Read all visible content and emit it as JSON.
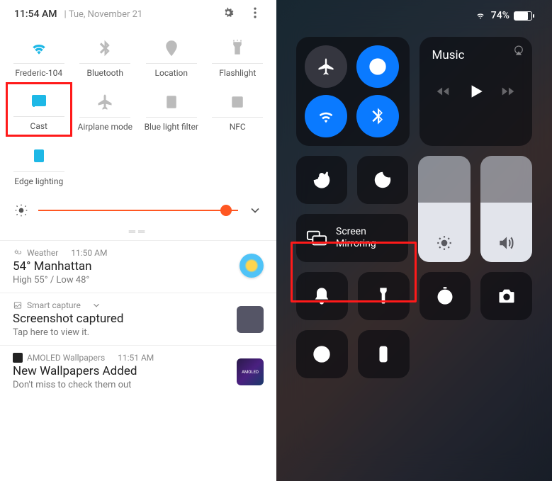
{
  "android": {
    "time": "11:54 AM",
    "date": "Tue, November 21",
    "tiles": [
      {
        "label": "Frederic-104",
        "icon": "wifi",
        "active": true
      },
      {
        "label": "Bluetooth",
        "icon": "bluetooth",
        "active": false
      },
      {
        "label": "Location",
        "icon": "location",
        "active": false
      },
      {
        "label": "Flashlight",
        "icon": "flashlight",
        "active": false
      },
      {
        "label": "Cast",
        "icon": "cast",
        "active": true,
        "highlight": true
      },
      {
        "label": "Airplane mode",
        "icon": "airplane",
        "active": false
      },
      {
        "label": "Blue light filter",
        "icon": "bluelight",
        "active": false
      },
      {
        "label": "NFC",
        "icon": "nfc",
        "active": false
      },
      {
        "label": "Edge lighting",
        "icon": "edge",
        "active": true
      }
    ],
    "brightness_percent": 94,
    "notifications": [
      {
        "app": "Weather",
        "time": "11:50 AM",
        "title": "54° Manhattan",
        "sub": "High 55° / Low 48°",
        "thumb": "sun"
      },
      {
        "app": "Smart capture",
        "time": "",
        "title": "Screenshot captured",
        "sub": "Tap here to view it.",
        "thumb": "gray",
        "chevron": true
      },
      {
        "app": "AMOLED Wallpapers",
        "time": "11:51 AM",
        "title": "New Wallpapers Added",
        "sub": "Don't miss to check them out",
        "thumb": "amoled"
      }
    ]
  },
  "ios": {
    "battery_text": "74%",
    "music_label": "Music",
    "screen_mirroring_label": "Screen\nMirroring",
    "brightness_percent": 56,
    "volume_percent": 56
  }
}
